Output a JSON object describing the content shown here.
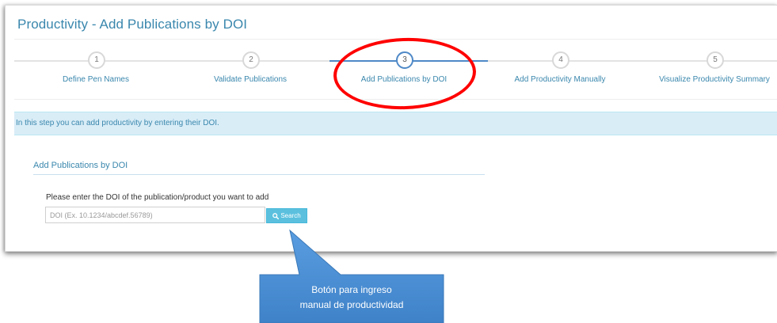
{
  "window": {
    "title": "Productivity - Add Publications by DOI"
  },
  "wizard": {
    "steps": [
      {
        "number": "1",
        "label": "Define Pen Names"
      },
      {
        "number": "2",
        "label": "Validate Publications"
      },
      {
        "number": "3",
        "label": "Add Publications by DOI"
      },
      {
        "number": "4",
        "label": "Add Productivity Manually"
      },
      {
        "number": "5",
        "label": "Visualize Productivity Summary"
      }
    ],
    "active_step": 3
  },
  "info": {
    "text": "In this step you can add productivity by entering their DOI."
  },
  "doi_section": {
    "title": "Add Publications by DOI",
    "prompt": "Please enter the DOI of the publication/product you want to add",
    "input_value": "",
    "input_placeholder": "DOI (Ex. 10.1234/abcdef.56789)",
    "search_label": "Search",
    "search_icon": "search-icon"
  },
  "callout": {
    "line1": "Botón para ingreso",
    "line2": "manual de productividad"
  },
  "colors": {
    "accent": "#3a87ad",
    "step_active": "#4f89c7",
    "info_bg": "#d9edf7",
    "button": "#5bc0de",
    "annotation_ellipse": "#ff0000",
    "callout": "#4a8fd4"
  }
}
